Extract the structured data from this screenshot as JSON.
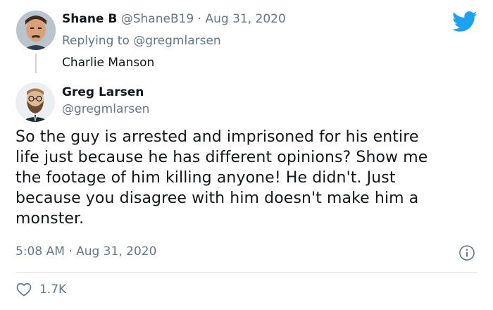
{
  "parent_tweet": {
    "author_name": "Shane B",
    "handle": "@ShaneB19",
    "separator": "·",
    "date": "Aug 31, 2020",
    "replying_prefix": "Replying to ",
    "replying_to": "@gregmlarsen",
    "text": "Charlie Manson"
  },
  "main_tweet": {
    "author_name": "Greg Larsen",
    "handle": "@gregmlarsen",
    "lines": [
      "So the guy is arrested and imprisoned for his entire",
      "life just because he has different opinions? Show me",
      "the footage of him killing anyone! He didn't. Just",
      "because you disagree with him doesn't make him a",
      "monster."
    ],
    "timestamp": "5:08 AM · Aug 31, 2020",
    "likes": "1.7K"
  },
  "icons": {
    "brand": "twitter-bird-icon",
    "info": "info-icon",
    "like": "heart-icon"
  },
  "colors": {
    "brand_blue": "#1da1f2",
    "muted_text": "#657786",
    "text": "#14171a",
    "divider": "#e1e8ed"
  }
}
